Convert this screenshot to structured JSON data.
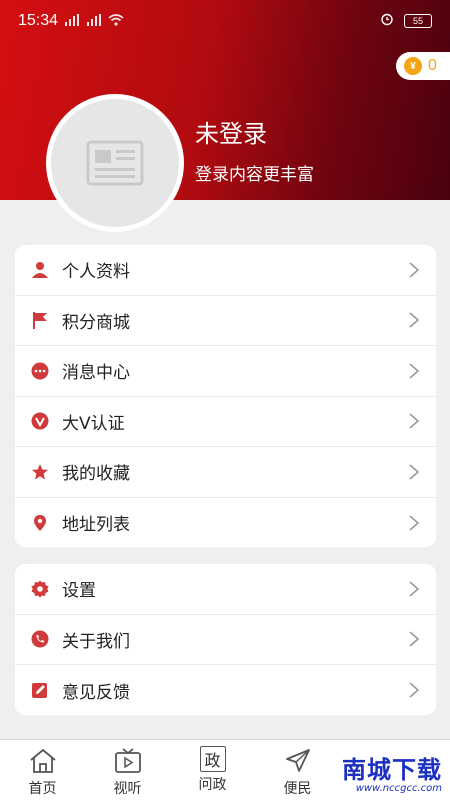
{
  "status_bar": {
    "time": "15:34",
    "signal_1": "5G",
    "signal_2": "4G",
    "battery": "55"
  },
  "coins": {
    "count": "0"
  },
  "user": {
    "name": "未登录",
    "subtitle": "登录内容更丰富"
  },
  "menu1": {
    "items": [
      {
        "label": "个人资料",
        "icon": "person-icon"
      },
      {
        "label": "积分商城",
        "icon": "flag-icon"
      },
      {
        "label": "消息中心",
        "icon": "message-icon"
      },
      {
        "label": "大V认证",
        "icon": "v-badge-icon"
      },
      {
        "label": "我的收藏",
        "icon": "star-icon"
      },
      {
        "label": "地址列表",
        "icon": "location-icon"
      }
    ]
  },
  "menu2": {
    "items": [
      {
        "label": "设置",
        "icon": "gear-icon"
      },
      {
        "label": "关于我们",
        "icon": "phone-icon"
      },
      {
        "label": "意见反馈",
        "icon": "edit-icon"
      }
    ]
  },
  "tabbar": {
    "tabs": [
      {
        "label": "首页",
        "icon": "home-icon"
      },
      {
        "label": "视听",
        "icon": "tv-icon"
      },
      {
        "label": "问政",
        "icon": "politics-icon",
        "icon_text": "政"
      },
      {
        "label": "便民",
        "icon": "send-icon"
      }
    ]
  },
  "watermark": {
    "main": "南城下载",
    "url": "www.nccgcc.com"
  },
  "colors": {
    "accent": "#d13a3a",
    "header_start": "#d40f12",
    "header_end": "#4a020e",
    "coin": "#f2a516"
  }
}
